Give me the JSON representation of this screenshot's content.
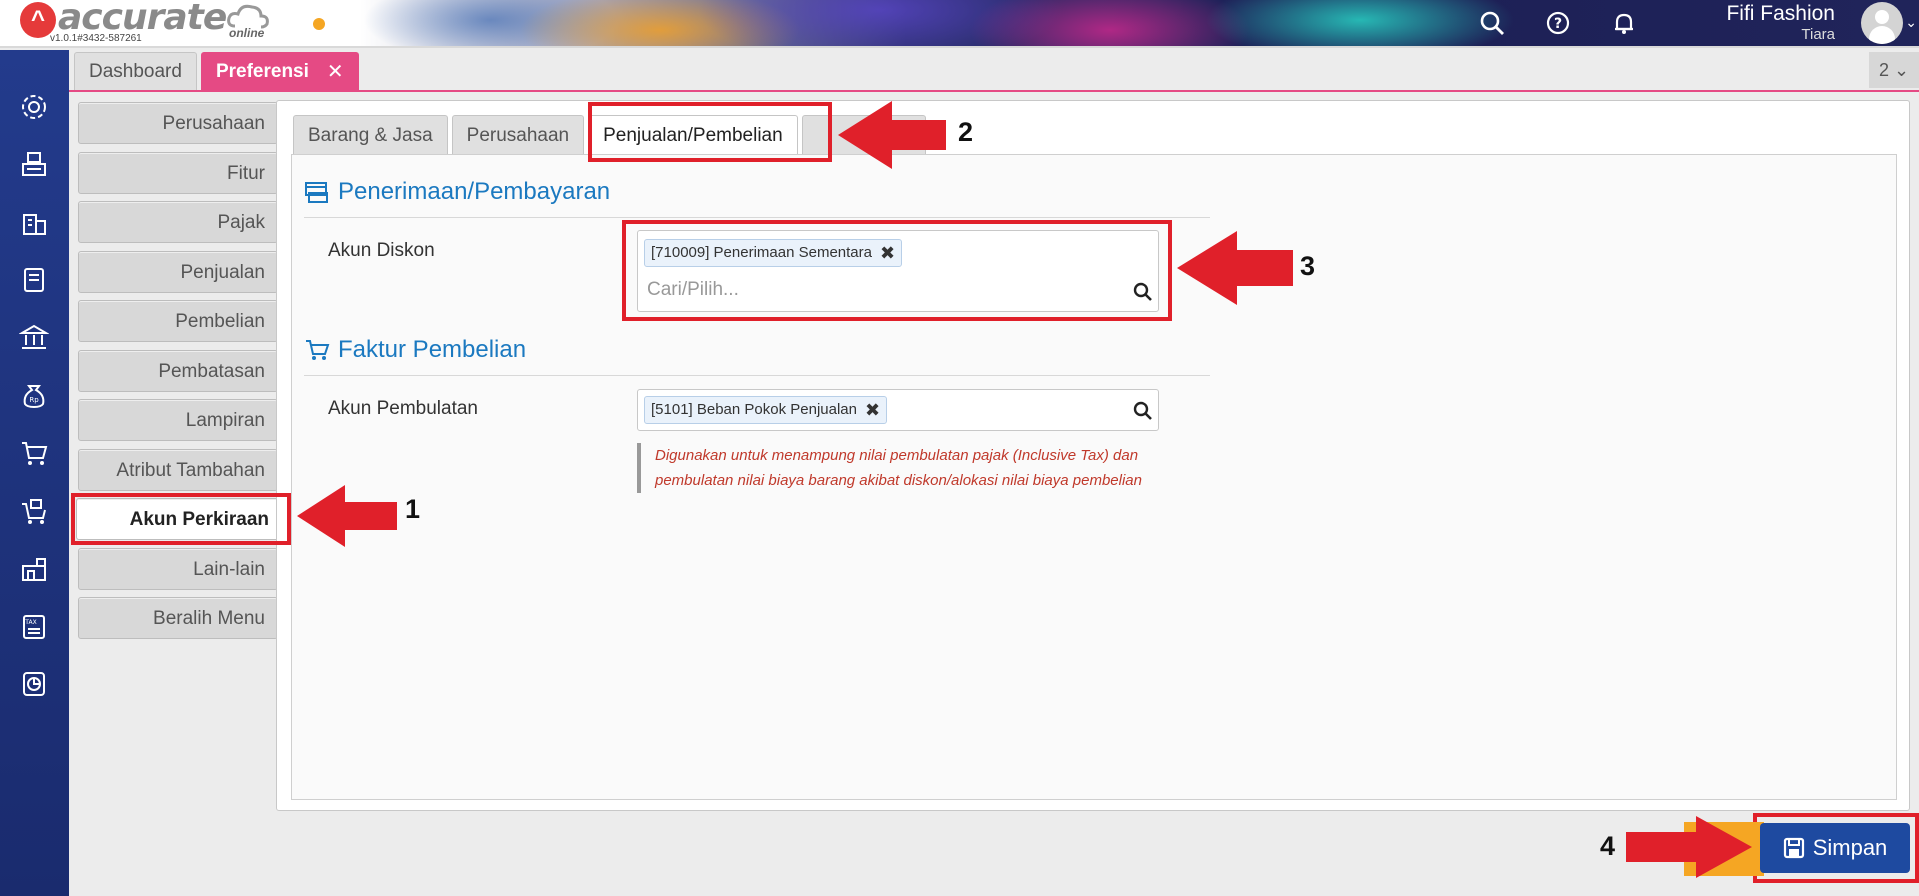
{
  "app": {
    "logo_text": "accurate",
    "logo_online": "online",
    "version": "v1.0.1#3432-587261",
    "company": "Fifi Fashion",
    "user": "Tiara"
  },
  "doc_tabs": [
    {
      "label": "Dashboard"
    },
    {
      "label": "Preferensi"
    }
  ],
  "tab_counter": "2 ⌄",
  "side_menu": [
    {
      "label": "Perusahaan"
    },
    {
      "label": "Fitur"
    },
    {
      "label": "Pajak"
    },
    {
      "label": "Penjualan"
    },
    {
      "label": "Pembelian"
    },
    {
      "label": "Pembatasan"
    },
    {
      "label": "Lampiran"
    },
    {
      "label": "Atribut Tambahan"
    },
    {
      "label": "Akun Perkiraan"
    },
    {
      "label": "Lain-lain"
    },
    {
      "label": "Beralih Menu"
    }
  ],
  "inner_tabs": [
    {
      "label": "Barang & Jasa"
    },
    {
      "label": "Perusahaan"
    },
    {
      "label": "Penjualan/Pembelian"
    },
    {
      "label": "P..."
    }
  ],
  "sections": {
    "receipt": {
      "title": "Penerimaan/Pembayaran",
      "label": "Akun Diskon",
      "chip": "[710009] Penerimaan Sementara",
      "placeholder": "Cari/Pilih..."
    },
    "purchase": {
      "title": "Faktur Pembelian",
      "label": "Akun Pembulatan",
      "chip": "[5101] Beban Pokok Penjualan",
      "note": "Digunakan untuk menampung nilai pembulatan pajak (Inclusive Tax) dan pembulatan nilai biaya barang akibat diskon/alokasi nilai biaya pembelian"
    }
  },
  "annotations": {
    "step1": "1",
    "step2": "2",
    "step3": "3",
    "step4": "4",
    "color": "#e0202a"
  },
  "save_button": "Simpan",
  "colors": {
    "accent_pink": "#e54a84",
    "primary_blue": "#1e4aa0",
    "section_blue": "#1b79c0",
    "nav_blue": "#233b8c"
  }
}
